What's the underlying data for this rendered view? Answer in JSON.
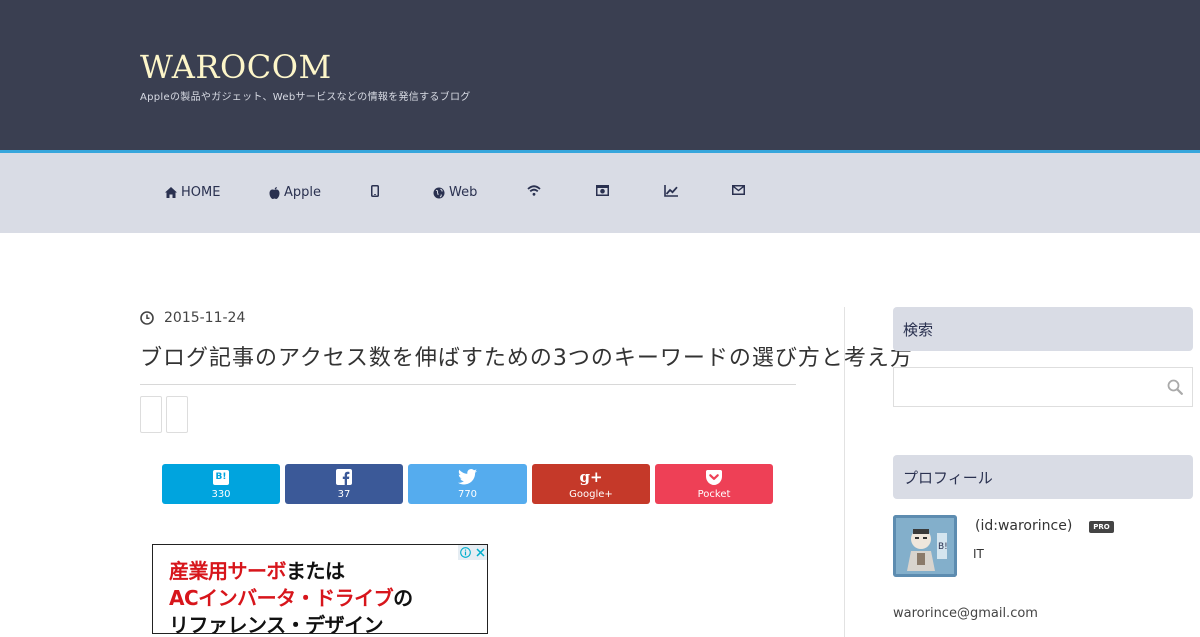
{
  "site": {
    "title": "WAROCOM",
    "description": "Appleの製品やガジェット、Webサービスなどの情報を発信するブログ"
  },
  "nav": {
    "items": [
      {
        "label": "HOME",
        "icon": "home-icon"
      },
      {
        "label": "Apple",
        "icon": "apple-icon"
      },
      {
        "label": "",
        "icon": "mobile-icon"
      },
      {
        "label": "Web",
        "icon": "globe-icon"
      },
      {
        "label": "",
        "icon": "wifi-icon"
      },
      {
        "label": "",
        "icon": "camera-icon"
      },
      {
        "label": "",
        "icon": "chart-icon"
      },
      {
        "label": "",
        "icon": "mail-icon"
      }
    ]
  },
  "article": {
    "date": "2015-11-24",
    "title": "ブログ記事のアクセス数を伸ばすための3つのキーワードの選び方と考え方"
  },
  "share": {
    "buttons": [
      {
        "service": "hatena",
        "label": "B!",
        "count": "330",
        "color": "#00a4de"
      },
      {
        "service": "facebook",
        "label": "",
        "count": "37",
        "color": "#3b5998"
      },
      {
        "service": "twitter",
        "label": "",
        "count": "770",
        "color": "#55acee"
      },
      {
        "service": "googleplus",
        "label": "",
        "count": "Google+",
        "color": "#c53929"
      },
      {
        "service": "pocket",
        "label": "",
        "count": "Pocket",
        "color": "#ee4056"
      }
    ]
  },
  "ad": {
    "lines": [
      {
        "parts": [
          {
            "text": "産業用サーボ",
            "color": "#d7151b"
          },
          {
            "text": "または",
            "color": "#111111"
          }
        ]
      },
      {
        "parts": [
          {
            "text": "ACインバータ・ドライブ",
            "color": "#d7151b"
          },
          {
            "text": "の",
            "color": "#111111"
          }
        ]
      },
      {
        "parts": [
          {
            "text": "リファレンス・デザイン",
            "color": "#111111"
          }
        ]
      }
    ]
  },
  "sidebar": {
    "search_heading": "検索",
    "profile_heading": "プロフィール",
    "profile": {
      "id": "(id:warorince)",
      "badge": "PRO",
      "description": "IT",
      "email": "warorince@gmail.com"
    }
  },
  "colors": {
    "header_bg": "#3a3f51",
    "nav_bg": "#d9dce5",
    "accent": "#37a6dc",
    "title": "#fdf6c9"
  }
}
